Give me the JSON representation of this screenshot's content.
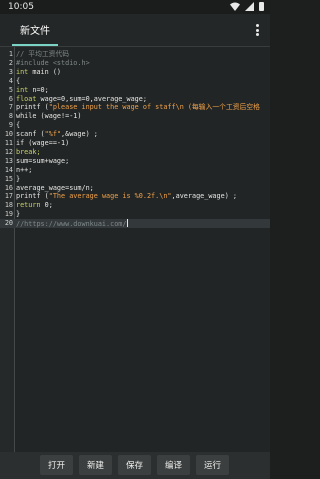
{
  "status_bar": {
    "time": "10:05"
  },
  "app_bar": {
    "tab_label": "新文件"
  },
  "editor": {
    "lines": [
      {
        "num": "1",
        "segments": [
          {
            "t": "// 平均工资代码",
            "c": "cm"
          }
        ]
      },
      {
        "num": "2",
        "segments": [
          {
            "t": "#include <stdio.h>",
            "c": "cm"
          }
        ]
      },
      {
        "num": "3",
        "segments": [
          {
            "t": "int",
            "c": "kw"
          },
          {
            "t": " main ()",
            "c": ""
          }
        ]
      },
      {
        "num": "4",
        "segments": [
          {
            "t": "{",
            "c": ""
          }
        ]
      },
      {
        "num": "5",
        "segments": [
          {
            "t": "int",
            "c": "kw"
          },
          {
            "t": " n=0;",
            "c": ""
          }
        ]
      },
      {
        "num": "6",
        "segments": [
          {
            "t": "float",
            "c": "kw"
          },
          {
            "t": " wage=0,sum=0,average_wage;",
            "c": ""
          }
        ]
      },
      {
        "num": "7",
        "segments": [
          {
            "t": "printf (",
            "c": ""
          },
          {
            "t": "\"please input the wage of staff\\n (每输入一个工资后空格",
            "c": "str"
          }
        ]
      },
      {
        "num": "8",
        "segments": [
          {
            "t": "while (wage!=-1)",
            "c": ""
          }
        ]
      },
      {
        "num": "9",
        "segments": [
          {
            "t": "{",
            "c": ""
          }
        ]
      },
      {
        "num": "10",
        "segments": [
          {
            "t": "scanf (",
            "c": ""
          },
          {
            "t": "\"%f\"",
            "c": "str"
          },
          {
            "t": ",&wage) ;",
            "c": ""
          }
        ]
      },
      {
        "num": "11",
        "segments": [
          {
            "t": "if (wage==-1)",
            "c": ""
          }
        ]
      },
      {
        "num": "12",
        "segments": [
          {
            "t": "break;",
            "c": "kw"
          }
        ]
      },
      {
        "num": "13",
        "segments": [
          {
            "t": "sum=sum+wage;",
            "c": ""
          }
        ]
      },
      {
        "num": "14",
        "segments": [
          {
            "t": "n++;",
            "c": ""
          }
        ]
      },
      {
        "num": "15",
        "segments": [
          {
            "t": "}",
            "c": ""
          }
        ]
      },
      {
        "num": "16",
        "segments": [
          {
            "t": "average_wage=sum/n;",
            "c": ""
          }
        ]
      },
      {
        "num": "17",
        "segments": [
          {
            "t": "printf (",
            "c": ""
          },
          {
            "t": "\"The average wage is %0.2f.\\n\"",
            "c": "str"
          },
          {
            "t": ",average_wage) ;",
            "c": ""
          }
        ]
      },
      {
        "num": "18",
        "segments": [
          {
            "t": "return",
            "c": "kw"
          },
          {
            "t": " 0;",
            "c": ""
          }
        ]
      },
      {
        "num": "19",
        "segments": [
          {
            "t": "}",
            "c": ""
          }
        ]
      },
      {
        "num": "20",
        "segments": [
          {
            "t": "//https://www.downkuai.com/",
            "c": "cm"
          }
        ],
        "current": true
      }
    ]
  },
  "bottom_bar": {
    "open_label": "打开",
    "new_label": "新建",
    "save_label": "保存",
    "compile_label": "编译",
    "run_label": "运行"
  },
  "colors": {
    "background": "#222525",
    "keyword": "#c7d46a",
    "string": "#f0a24a",
    "comment": "#7f8888",
    "tab_indicator": "#7ad3c4"
  }
}
